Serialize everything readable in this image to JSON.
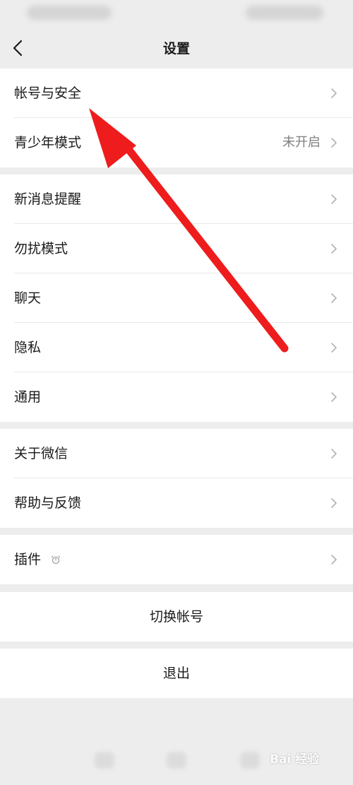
{
  "nav": {
    "title": "设置"
  },
  "sections": [
    {
      "items": [
        {
          "label": "帐号与安全"
        },
        {
          "label": "青少年模式",
          "value": "未开启"
        }
      ]
    },
    {
      "items": [
        {
          "label": "新消息提醒"
        },
        {
          "label": "勿扰模式"
        },
        {
          "label": "聊天"
        },
        {
          "label": "隐私"
        },
        {
          "label": "通用"
        }
      ]
    },
    {
      "items": [
        {
          "label": "关于微信"
        },
        {
          "label": "帮助与反馈"
        }
      ]
    },
    {
      "items": [
        {
          "label": "插件"
        }
      ]
    }
  ],
  "actions": {
    "switch_account": "切换帐号",
    "logout": "退出"
  },
  "watermark": "Bai 经验",
  "colors": {
    "arrow": "#ee1c1c",
    "background": "#ededed",
    "secondary_text": "#7f7f7f"
  },
  "icons": {
    "back": "chevron-left-icon",
    "row": "chevron-right-icon",
    "plugin": "plugin-icon"
  }
}
